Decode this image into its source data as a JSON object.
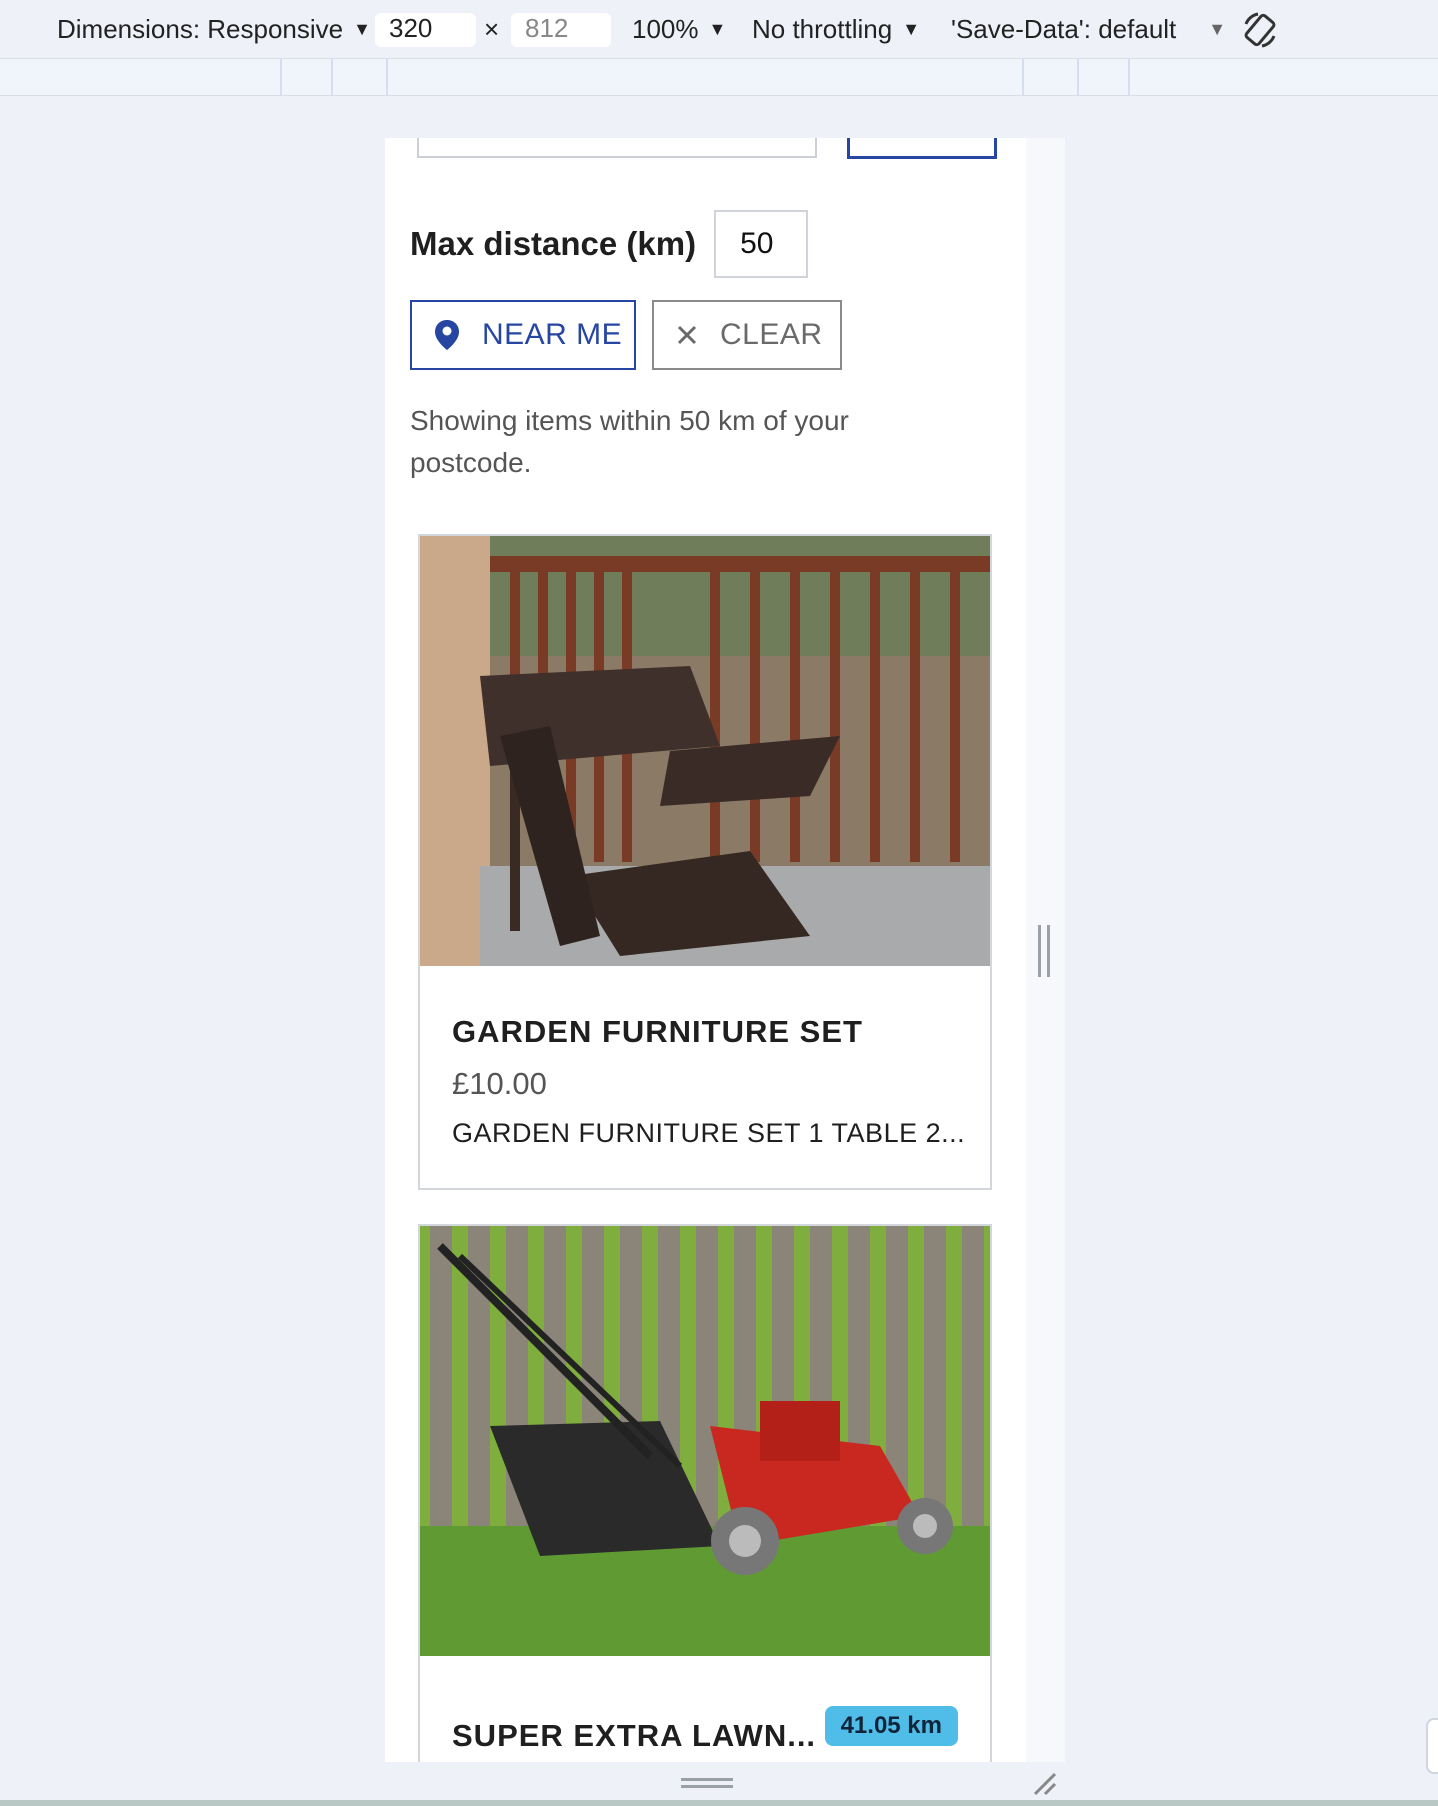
{
  "toolbar": {
    "dimensions_label": "Dimensions: Responsive",
    "width_value": "320",
    "times": "×",
    "height_placeholder": "812",
    "zoom_label": "100%",
    "throttling_label": "No throttling",
    "save_data_label": "'Save-Data': default"
  },
  "filters": {
    "distance_label": "Max distance (km)",
    "distance_value": "50",
    "near_me_label": "NEAR ME",
    "clear_label": "CLEAR",
    "status_text": "Showing items within 50 km of your postcode."
  },
  "listings": [
    {
      "title": "GARDEN FURNITURE SET",
      "price": "£10.00",
      "description": "GARDEN FURNITURE SET 1 TABLE 2..."
    },
    {
      "title": "SUPER EXTRA LAWN...",
      "distance_badge": "41.05 km"
    }
  ],
  "colors": {
    "accent": "#2646a1",
    "badge": "#4fbde8"
  }
}
